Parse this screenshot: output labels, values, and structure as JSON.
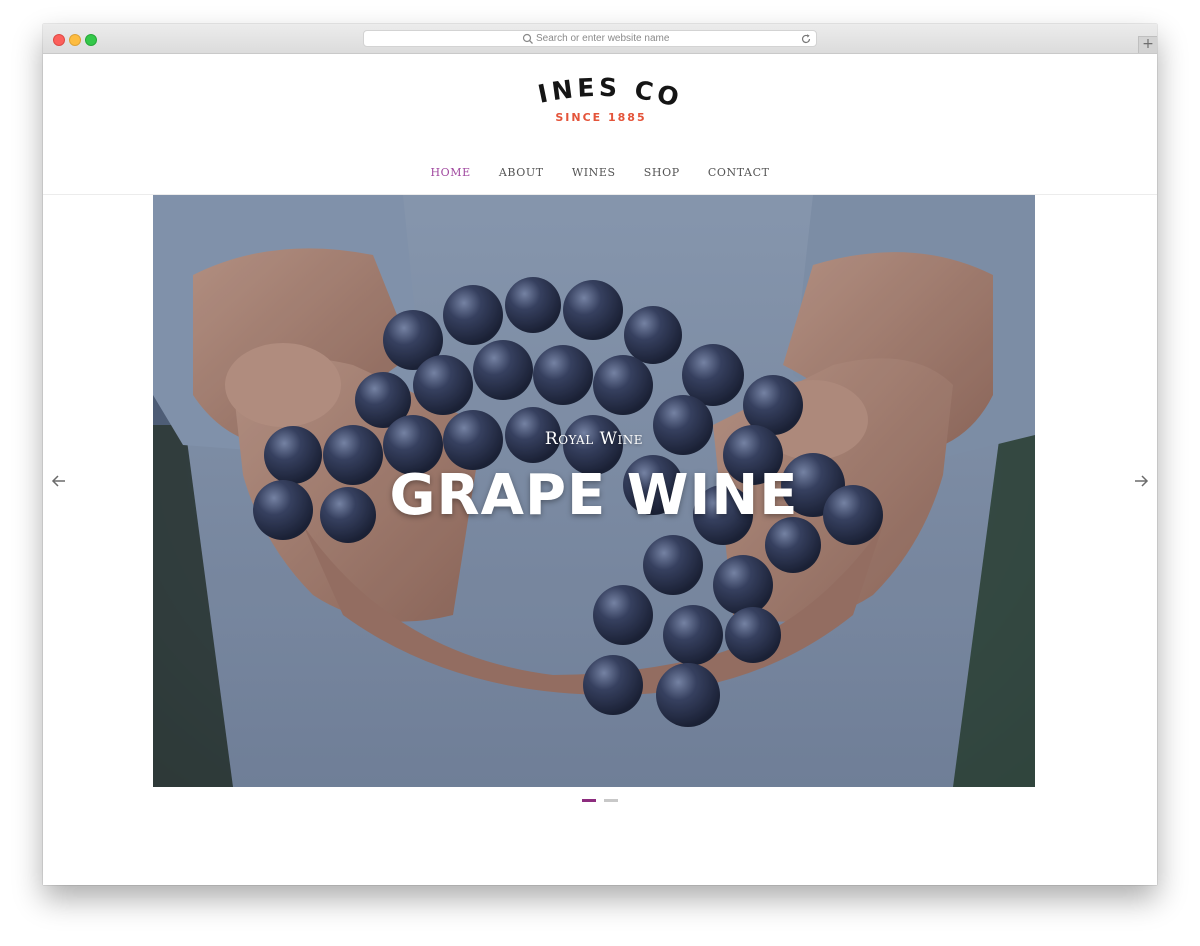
{
  "browser": {
    "address_placeholder": "Search or enter website name",
    "new_tab_symbol": "+"
  },
  "brand": {
    "name": "WINES CO.",
    "tagline": "SINCE 1885",
    "tagline_color": "#e4543a"
  },
  "nav": {
    "items": [
      {
        "label": "HOME",
        "active": true
      },
      {
        "label": "ABOUT",
        "active": false
      },
      {
        "label": "WINES",
        "active": false
      },
      {
        "label": "SHOP",
        "active": false
      },
      {
        "label": "CONTACT",
        "active": false
      }
    ],
    "active_color": "#a14aa0"
  },
  "hero": {
    "kicker": "Royal Wine",
    "title": "GRAPE WINE",
    "slide_count": 2,
    "active_slide": 1,
    "accent_color": "#8d2c7e"
  },
  "icons": {
    "prev": "arrow-left-icon",
    "next": "arrow-right-icon",
    "search": "search-icon",
    "reload": "reload-icon"
  }
}
